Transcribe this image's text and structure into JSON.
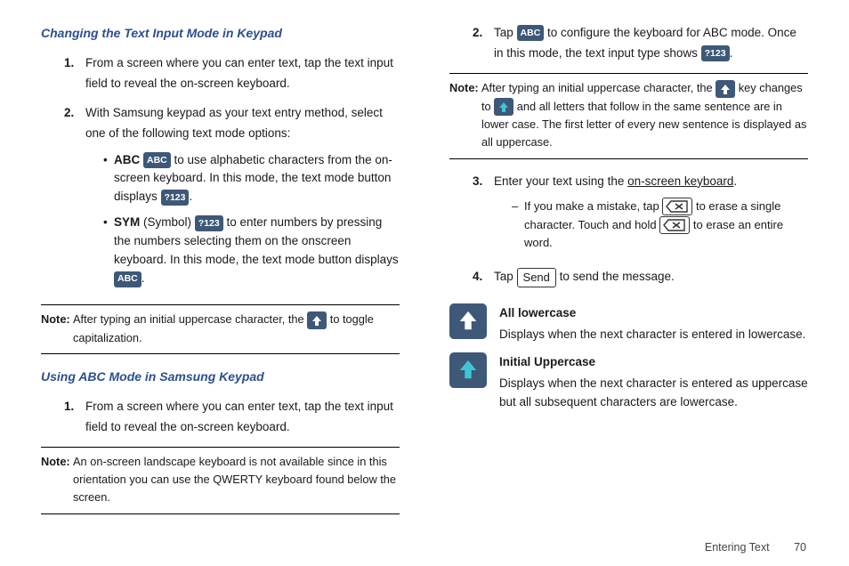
{
  "left": {
    "heading1": "Changing the Text Input Mode in Keypad",
    "step1_num": "1.",
    "step1": "From a screen where you can enter text, tap the text input field to reveal the on-screen keyboard.",
    "step2_num": "2.",
    "step2": "With Samsung keypad as your text entry method, select one of the following text mode options:",
    "bullet_abc_label": "ABC",
    "abc_badge": "ABC",
    "bullet_abc_a": " to use alphabetic characters from the on-screen keyboard. In this mode, the text mode button displays ",
    "p123_badge": "?123",
    "bullet_sym_label": "SYM",
    "bullet_sym_paren": " (Symbol) ",
    "bullet_sym_a": " to enter numbers by pressing the numbers selecting them on the onscreen keyboard. In this mode, the text mode button displays ",
    "note1_label": "Note:",
    "note1_a": "After typing an initial uppercase character, the ",
    "note1_b": " to toggle capitalization.",
    "heading2": "Using ABC Mode in Samsung Keypad",
    "h2_step1_num": "1.",
    "h2_step1": "From a screen where you can enter text, tap the text input field to reveal the on-screen keyboard.",
    "note2_label": "Note:",
    "note2": "An on-screen landscape keyboard is not available since in this orientation you can use the QWERTY keyboard found below the screen."
  },
  "right": {
    "step2_num": "2.",
    "step2_a": "Tap ",
    "abc_badge": "ABC",
    "step2_b": " to configure the keyboard for ABC mode. Once in this mode, the text input type shows ",
    "p123_badge": "?123",
    "note_label": "Note:",
    "note_a": "After typing an initial uppercase character, the ",
    "note_b": " key changes to ",
    "note_c": " and all letters that follow in the same sentence are in lower case. The first letter of every new sentence is displayed as all uppercase.",
    "step3_num": "3.",
    "step3_a": "Enter your text using the ",
    "step3_b": "on-screen keyboard",
    "step3_c": ".",
    "dash_a": "If you make a mistake, tap ",
    "dash_b": " to erase a single character. Touch and hold ",
    "dash_c": " to erase an entire word.",
    "step4_num": "4.",
    "step4_a": "Tap ",
    "send_label": "Send",
    "step4_b": " to send the message.",
    "info1_title": "All lowercase",
    "info1_body": "Displays when the next character is entered in lowercase.",
    "info2_title": "Initial Uppercase",
    "info2_body": "Displays when the next character is entered as uppercase but all subsequent characters are lowercase."
  },
  "footer": {
    "section": "Entering Text",
    "page": "70"
  }
}
